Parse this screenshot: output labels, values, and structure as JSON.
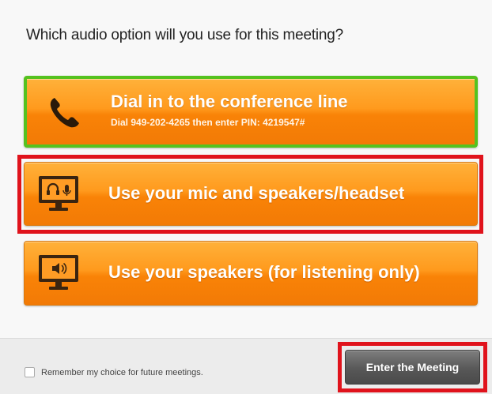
{
  "dialog": {
    "question": "Which audio option will you use for this meeting?"
  },
  "options": {
    "dial": {
      "title": "Dial in to the conference line",
      "subtitle": "Dial 949-202-4265 then enter PIN: 4219547#",
      "icon": "phone-icon"
    },
    "mic": {
      "title": "Use your mic and speakers/headset",
      "icon": "monitor-headset-icon"
    },
    "speakers": {
      "title": "Use your speakers (for listening only)",
      "icon": "monitor-speaker-icon"
    }
  },
  "footer": {
    "remember_label": "Remember my choice for future meetings.",
    "enter_label": "Enter the Meeting"
  },
  "colors": {
    "option_orange": "#f98307",
    "selected_border": "#55c21f",
    "highlight_red": "#e0131c",
    "enter_button": "#585858"
  }
}
